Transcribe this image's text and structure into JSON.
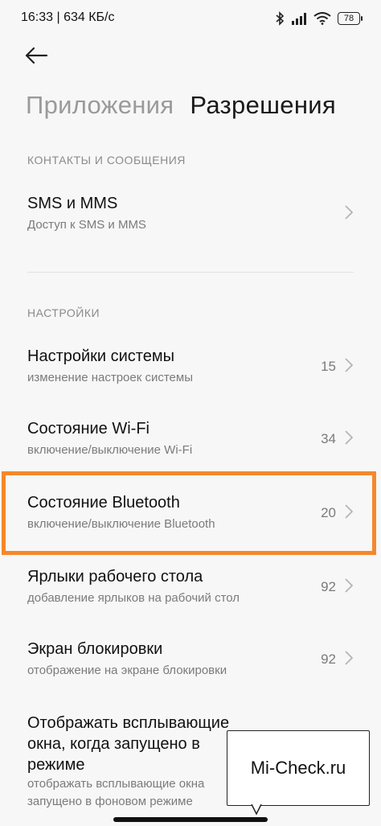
{
  "status_bar": {
    "time": "16:33 | 634 КБ/с",
    "battery": "78",
    "icons": [
      "bluetooth-icon",
      "signal-icon",
      "wifi-icon",
      "battery-icon"
    ]
  },
  "header": {
    "tabs": [
      {
        "label": "Приложения",
        "active": false
      },
      {
        "label": "Разрешения",
        "active": true
      }
    ]
  },
  "sections": {
    "contacts_title": "КОНТАКТЫ И СООБЩЕНИЯ",
    "settings_title": "НАСТРОЙКИ"
  },
  "items": [
    {
      "title": "SMS и MMS",
      "subtitle": "Доступ к SMS и MMS",
      "count": ""
    },
    {
      "title": "Настройки системы",
      "subtitle": "изменение настроек системы",
      "count": "15"
    },
    {
      "title": "Состояние Wi-Fi",
      "subtitle": "включение/выключение Wi-Fi",
      "count": "34"
    },
    {
      "title": "Состояние Bluetooth",
      "subtitle": "включение/выключение Bluetooth",
      "count": "20"
    },
    {
      "title": "Ярлыки рабочего стола",
      "subtitle": "добавление ярлыков на рабочий стол",
      "count": "92"
    },
    {
      "title": "Экран блокировки",
      "subtitle": "отображение на экране блокировки",
      "count": "92"
    },
    {
      "title_lines": [
        "Отображать всплывающие",
        "окна, когда запущено в",
        "режиме"
      ],
      "subtitle_lines": [
        "отображать всплывающие окна",
        "запущено в фоновом режиме"
      ]
    }
  ],
  "highlight_color": "#f5882b",
  "watermark": "Mi-Check.ru"
}
